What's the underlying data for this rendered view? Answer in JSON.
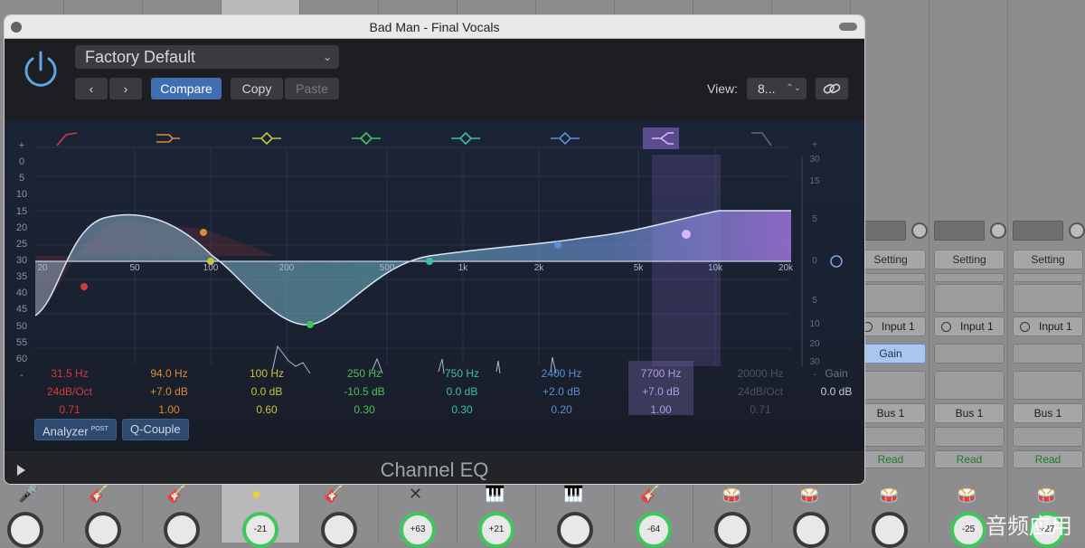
{
  "window": {
    "title": "Bad Man - Final Vocals"
  },
  "header": {
    "preset": "Factory Default",
    "compare": "Compare",
    "copy": "Copy",
    "paste": "Paste",
    "view_label": "View:",
    "view_value": "8..."
  },
  "eq": {
    "left_scale": [
      "+",
      "0",
      "5",
      "10",
      "15",
      "20",
      "25",
      "30",
      "35",
      "40",
      "45",
      "50",
      "55",
      "60",
      "-"
    ],
    "right_scale": [
      "+",
      "30",
      "15",
      "5",
      "0",
      "5",
      "10",
      "20",
      "30",
      "-"
    ],
    "freq_labels": [
      "20",
      "50",
      "100",
      "200",
      "500",
      "1k",
      "2k",
      "5k",
      "10k",
      "20k"
    ],
    "bands": [
      {
        "freq": "31.5 Hz",
        "gain": "24dB/Oct",
        "q": "0.71",
        "color": "#d23b3b",
        "dim": false
      },
      {
        "freq": "94.0 Hz",
        "gain": "+7.0 dB",
        "q": "1.00",
        "color": "#e08a2e",
        "dim": false
      },
      {
        "freq": "100 Hz",
        "gain": "0.0 dB",
        "q": "0.60",
        "color": "#c9c23b",
        "dim": false
      },
      {
        "freq": "250 Hz",
        "gain": "-10.5 dB",
        "q": "0.30",
        "color": "#48c25a",
        "dim": false
      },
      {
        "freq": "750 Hz",
        "gain": "0.0 dB",
        "q": "0.30",
        "color": "#3ac1a3",
        "dim": false
      },
      {
        "freq": "2400 Hz",
        "gain": "+2.0 dB",
        "q": "0.20",
        "color": "#5a8fd8",
        "dim": false
      },
      {
        "freq": "7700 Hz",
        "gain": "+7.0 dB",
        "q": "1.00",
        "color": "#b39ae8",
        "dim": false
      },
      {
        "freq": "20000 Hz",
        "gain": "24dB/Oct",
        "q": "0.71",
        "color": "#6a6f7a",
        "dim": true
      }
    ],
    "gain_label": "Gain",
    "gain_value": "0.0 dB"
  },
  "footer": {
    "analyzer": "Analyzer",
    "analyzer_sup": "POST",
    "qcouple": "Q-Couple",
    "plugin_name": "Channel EQ"
  },
  "mixer": {
    "setting": "Setting",
    "input": "Input 1",
    "gain": "Gain",
    "bus": "Bus 1",
    "read": "Read",
    "knob_values": [
      "-21",
      "+63",
      "+21",
      "-64",
      "-25",
      "+27"
    ],
    "watermark": "音频应用"
  }
}
